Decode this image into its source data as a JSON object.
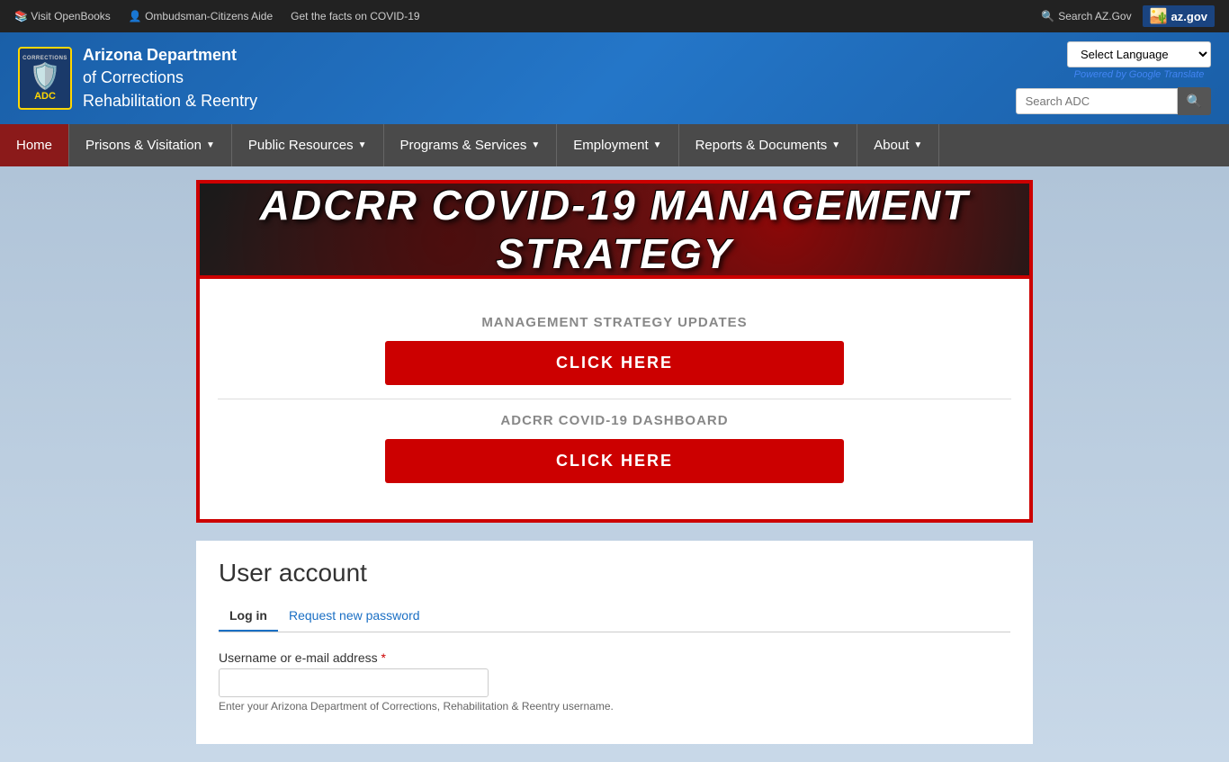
{
  "topbar": {
    "links": [
      {
        "id": "visit-openbooks",
        "label": "Visit OpenBooks",
        "icon": "book-icon"
      },
      {
        "id": "ombudsman",
        "label": "Ombudsman-Citizens Aide",
        "icon": "person-icon"
      },
      {
        "id": "covid-facts",
        "label": "Get the facts on COVID-19",
        "icon": ""
      }
    ],
    "search_az": "Search AZ.Gov",
    "az_gov": "az.gov"
  },
  "header": {
    "org_line1": "Arizona Department",
    "org_line2": "of Corrections",
    "org_line3": "Rehabilitation & Reentry",
    "corrections_text": "CORRECTIONS",
    "adc_text": "ADC",
    "language_select_label": "Select Language",
    "powered_by": "Powered by",
    "google": "Google",
    "translate": "Translate",
    "search_placeholder": "Search ADC"
  },
  "nav": {
    "items": [
      {
        "id": "home",
        "label": "Home",
        "has_dropdown": false,
        "is_home": true
      },
      {
        "id": "prisons",
        "label": "Prisons & Visitation",
        "has_dropdown": true
      },
      {
        "id": "public-resources",
        "label": "Public Resources",
        "has_dropdown": true
      },
      {
        "id": "programs-services",
        "label": "Programs & Services",
        "has_dropdown": true
      },
      {
        "id": "employment",
        "label": "Employment",
        "has_dropdown": true
      },
      {
        "id": "reports-documents",
        "label": "Reports & Documents",
        "has_dropdown": true
      },
      {
        "id": "about",
        "label": "About",
        "has_dropdown": true
      }
    ]
  },
  "covid_banner": {
    "title": "ADCRR COVID-19 MANAGEMENT STRATEGY"
  },
  "covid_sections": [
    {
      "id": "management-strategy",
      "label": "MANAGEMENT STRATEGY UPDATES",
      "button_text": "CLICK HERE"
    },
    {
      "id": "covid-dashboard",
      "label": "ADCRR COVID-19 DASHBOARD",
      "button_text": "CLICK HERE"
    }
  ],
  "user_account": {
    "title": "User account",
    "tabs": [
      {
        "id": "log-in",
        "label": "Log in",
        "active": true
      },
      {
        "id": "request-password",
        "label": "Request new password",
        "active": false
      }
    ],
    "form": {
      "username_label": "Username or e-mail address",
      "username_required": true,
      "username_hint": "Enter your Arizona Department of Corrections, Rehabilitation & Reentry username."
    }
  }
}
